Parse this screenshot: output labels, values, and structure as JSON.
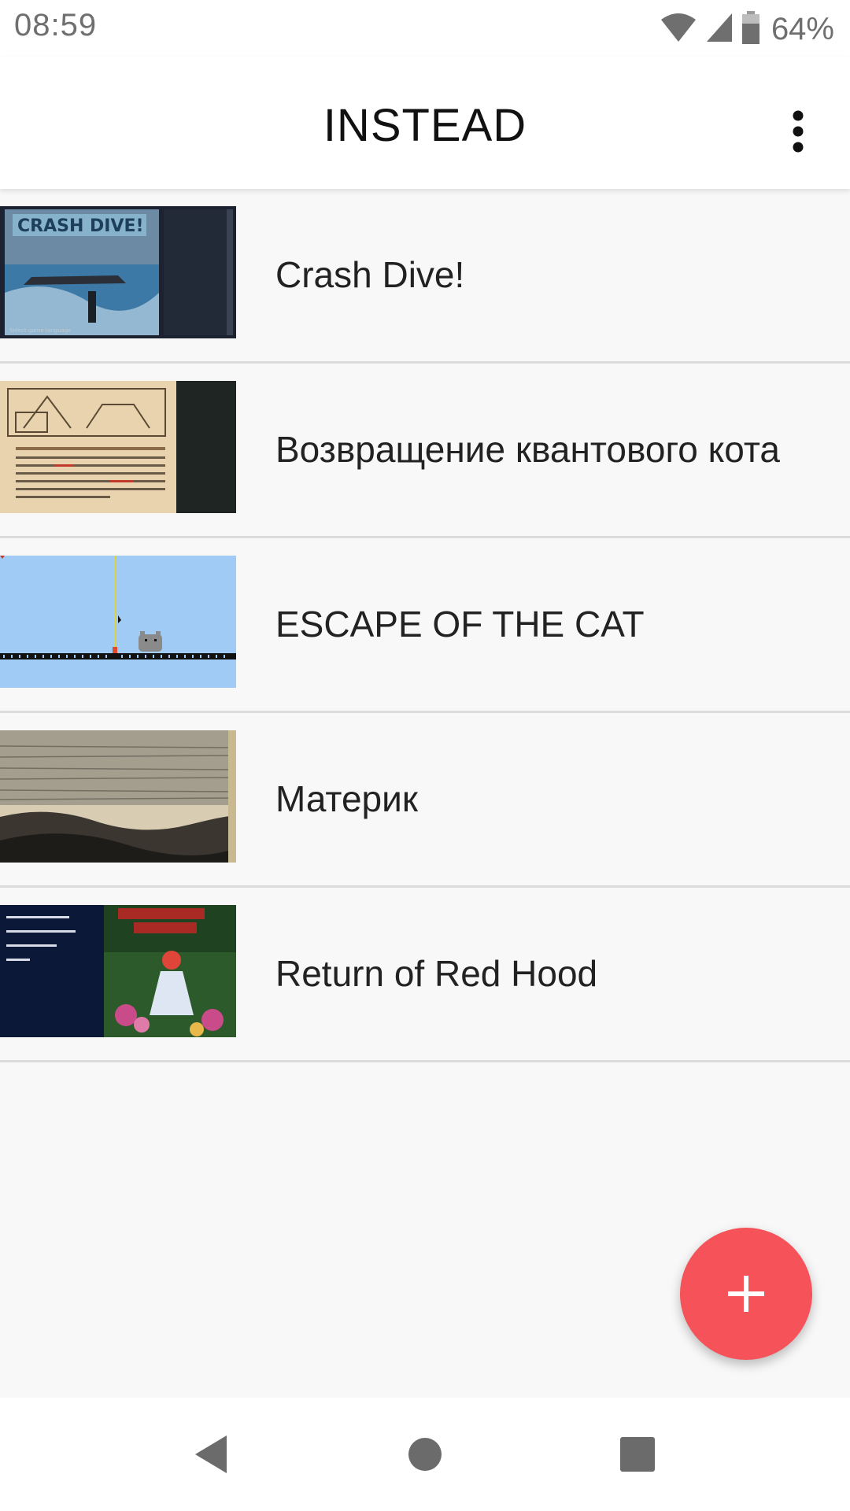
{
  "status_bar": {
    "time": "08:59",
    "battery_percent": "64%",
    "icons": [
      "wifi-icon",
      "cell-signal-icon",
      "battery-icon"
    ]
  },
  "app_bar": {
    "title": "INSTEAD",
    "menu_icon": "more-vert-icon"
  },
  "games": [
    {
      "title": "Crash Dive!"
    },
    {
      "title": "Возвращение квантового кота"
    },
    {
      "title": "ESCAPE OF THE CAT"
    },
    {
      "title": "Материк"
    },
    {
      "title": "Return of Red Hood"
    }
  ],
  "fab": {
    "icon": "plus-icon",
    "color": "#f5525a"
  },
  "nav_bar": {
    "icons": [
      "back-icon",
      "home-icon",
      "recents-icon"
    ]
  },
  "colors": {
    "accent": "#f5525a",
    "background": "#f8f8f8",
    "divider": "#dcdcdc"
  }
}
